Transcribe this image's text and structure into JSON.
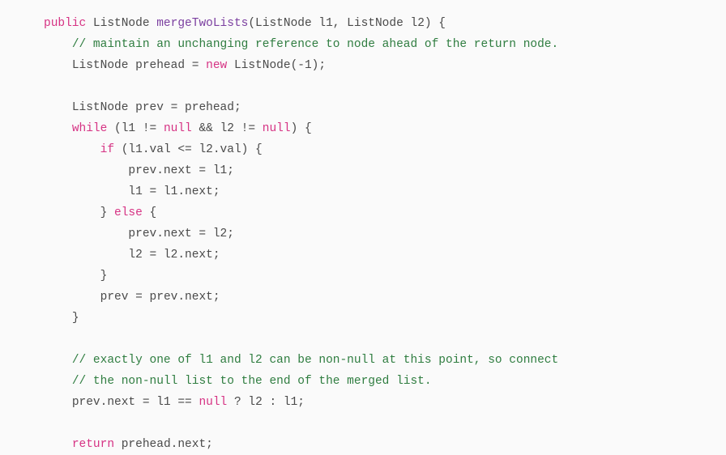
{
  "document": {
    "kind": "code-snippet",
    "language": "Java",
    "background_color": "#fafafa",
    "font_size_px": 14.5,
    "line_height_px": 26,
    "indent_spaces": 4
  },
  "colors": {
    "keyword": "#d63384",
    "function_name": "#7b3fa0",
    "comment": "#2f7d40",
    "plain": "#4a4a4a",
    "background": "#fafafa"
  },
  "code": {
    "lines": [
      {
        "index": 1,
        "indent": 0,
        "text": "public ListNode mergeTwoLists(ListNode l1, ListNode l2) {",
        "tokens": [
          {
            "t": "public",
            "c": "kw"
          },
          {
            "t": " ListNode ",
            "c": "plain"
          },
          {
            "t": "mergeTwoLists",
            "c": "fn"
          },
          {
            "t": "(ListNode l1, ListNode l2) {",
            "c": "plain"
          }
        ]
      },
      {
        "index": 2,
        "indent": 1,
        "text": "// maintain an unchanging reference to node ahead of the return node.",
        "tokens": [
          {
            "t": "// maintain an unchanging reference to node ahead of the return node.",
            "c": "comment"
          }
        ]
      },
      {
        "index": 3,
        "indent": 1,
        "text": "ListNode prehead = new ListNode(-1);",
        "tokens": [
          {
            "t": "ListNode prehead = ",
            "c": "plain"
          },
          {
            "t": "new",
            "c": "kw"
          },
          {
            "t": " ListNode(-1);",
            "c": "plain"
          }
        ]
      },
      {
        "index": 4,
        "indent": 0,
        "text": "",
        "tokens": []
      },
      {
        "index": 5,
        "indent": 1,
        "text": "ListNode prev = prehead;",
        "tokens": [
          {
            "t": "ListNode prev = prehead;",
            "c": "plain"
          }
        ]
      },
      {
        "index": 6,
        "indent": 1,
        "text": "while (l1 != null && l2 != null) {",
        "tokens": [
          {
            "t": "while",
            "c": "kw"
          },
          {
            "t": " (l1 != ",
            "c": "plain"
          },
          {
            "t": "null",
            "c": "kw"
          },
          {
            "t": " && l2 != ",
            "c": "plain"
          },
          {
            "t": "null",
            "c": "kw"
          },
          {
            "t": ") {",
            "c": "plain"
          }
        ]
      },
      {
        "index": 7,
        "indent": 2,
        "text": "if (l1.val <= l2.val) {",
        "tokens": [
          {
            "t": "if",
            "c": "kw"
          },
          {
            "t": " (l1.val <= l2.val) {",
            "c": "plain"
          }
        ]
      },
      {
        "index": 8,
        "indent": 3,
        "text": "prev.next = l1;",
        "tokens": [
          {
            "t": "prev.next = l1;",
            "c": "plain"
          }
        ]
      },
      {
        "index": 9,
        "indent": 3,
        "text": "l1 = l1.next;",
        "tokens": [
          {
            "t": "l1 = l1.next;",
            "c": "plain"
          }
        ]
      },
      {
        "index": 10,
        "indent": 2,
        "text": "} else {",
        "tokens": [
          {
            "t": "} ",
            "c": "plain"
          },
          {
            "t": "else",
            "c": "kw"
          },
          {
            "t": " {",
            "c": "plain"
          }
        ]
      },
      {
        "index": 11,
        "indent": 3,
        "text": "prev.next = l2;",
        "tokens": [
          {
            "t": "prev.next = l2;",
            "c": "plain"
          }
        ]
      },
      {
        "index": 12,
        "indent": 3,
        "text": "l2 = l2.next;",
        "tokens": [
          {
            "t": "l2 = l2.next;",
            "c": "plain"
          }
        ]
      },
      {
        "index": 13,
        "indent": 2,
        "text": "}",
        "tokens": [
          {
            "t": "}",
            "c": "plain"
          }
        ]
      },
      {
        "index": 14,
        "indent": 2,
        "text": "prev = prev.next;",
        "tokens": [
          {
            "t": "prev = prev.next;",
            "c": "plain"
          }
        ]
      },
      {
        "index": 15,
        "indent": 1,
        "text": "}",
        "tokens": [
          {
            "t": "}",
            "c": "plain"
          }
        ]
      },
      {
        "index": 16,
        "indent": 0,
        "text": "",
        "tokens": []
      },
      {
        "index": 17,
        "indent": 1,
        "text": "// exactly one of l1 and l2 can be non-null at this point, so connect",
        "tokens": [
          {
            "t": "// exactly one of l1 and l2 can be non-null at this point, so connect",
            "c": "comment"
          }
        ]
      },
      {
        "index": 18,
        "indent": 1,
        "text": "// the non-null list to the end of the merged list.",
        "tokens": [
          {
            "t": "// the non-null list to the end of the merged list.",
            "c": "comment"
          }
        ]
      },
      {
        "index": 19,
        "indent": 1,
        "text": "prev.next = l1 == null ? l2 : l1;",
        "tokens": [
          {
            "t": "prev.next = l1 == ",
            "c": "plain"
          },
          {
            "t": "null",
            "c": "kw"
          },
          {
            "t": " ? l2 : l1;",
            "c": "plain"
          }
        ]
      },
      {
        "index": 20,
        "indent": 0,
        "text": "",
        "tokens": []
      },
      {
        "index": 21,
        "indent": 1,
        "text": "return prehead.next;",
        "tokens": [
          {
            "t": "return",
            "c": "kw"
          },
          {
            "t": " prehead.next;",
            "c": "plain"
          }
        ]
      }
    ]
  }
}
